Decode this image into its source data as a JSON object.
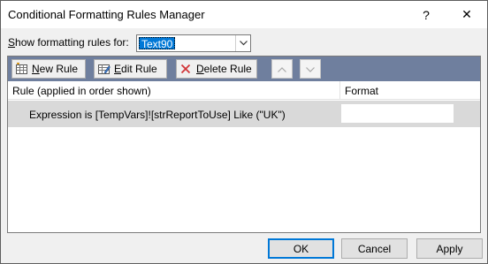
{
  "window": {
    "title": "Conditional Formatting Rules Manager",
    "help_glyph": "?",
    "close_glyph": "✕"
  },
  "filter": {
    "label_pre": "",
    "label_accel": "S",
    "label_post": "how formatting rules for:",
    "selected_value": "Text90"
  },
  "toolbar": {
    "new_accel": "N",
    "new_rest": "ew Rule",
    "edit_accel": "E",
    "edit_rest": "dit Rule",
    "delete_accel": "D",
    "delete_rest": "elete Rule"
  },
  "table": {
    "col_rule": "Rule (applied in order shown)",
    "col_format": "Format",
    "rows": [
      {
        "rule": "Expression is [TempVars]![strReportToUse] Like (\"UK\")"
      }
    ]
  },
  "buttons": {
    "ok": "OK",
    "cancel": "Cancel",
    "apply": "Apply"
  },
  "colors": {
    "toolbar_bg": "#6f7f9e",
    "selection": "#0078d7",
    "row_selected": "#d9d9d9"
  }
}
